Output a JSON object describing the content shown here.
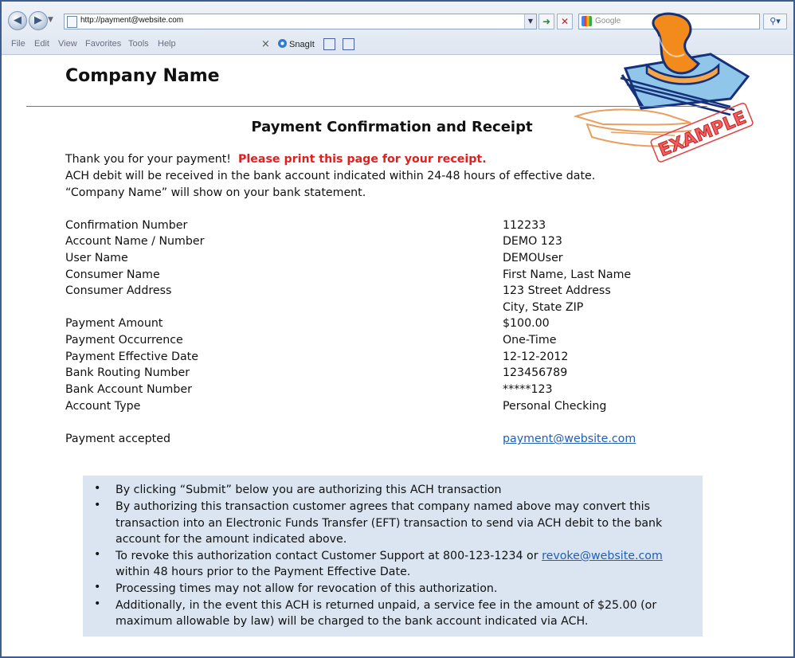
{
  "browser": {
    "url": "http://payment@website.com",
    "search_placeholder": "Google",
    "menu": [
      "File",
      "Edit",
      "View",
      "Favorites",
      "Tools",
      "Help"
    ],
    "toolbar_snagit": "SnagIt"
  },
  "page": {
    "company_name": "Company Name",
    "title": "Payment Confirmation and Receipt",
    "thanks": "Thank you for your payment!",
    "print_notice": "Please print this page for your receipt.",
    "line2": "ACH debit will be received in the bank account indicated within 24-48 hours of effective date.",
    "line3": "“Company Name” will show on your bank statement.",
    "stamp_text": "EXAMPLE"
  },
  "details": [
    {
      "label": "Confirmation Number",
      "value": "112233"
    },
    {
      "label": "Account Name / Number",
      "value": "DEMO 123"
    },
    {
      "label": "User Name",
      "value": "DEMOUser"
    },
    {
      "label": "Consumer Name",
      "value": "First Name, Last Name"
    },
    {
      "label": "Consumer Address",
      "value": "123 Street Address"
    },
    {
      "label": "",
      "value": "City, State ZIP"
    },
    {
      "label": "Payment Amount",
      "value": "$100.00"
    },
    {
      "label": "Payment Occurrence",
      "value": "One-Time"
    },
    {
      "label": "Payment Effective Date",
      "value": "12-12-2012"
    },
    {
      "label": "Bank Routing Number",
      "value": "123456789"
    },
    {
      "label": "Bank Account Number",
      "value": "*****123"
    },
    {
      "label": "Account Type",
      "value": "Personal Checking"
    }
  ],
  "accepted": {
    "label": "Payment accepted",
    "email": "payment@website.com"
  },
  "notice": {
    "b1": "By clicking “Submit” below you are authorizing this ACH transaction",
    "b2_l1": "By authorizing this transaction customer agrees that company named above may convert this",
    "b2_l2": "transaction into an Electronic Funds Transfer (EFT) transaction to send via ACH debit to the bank",
    "b2_l3": "account for the amount indicated above.",
    "b3_l1": "To revoke this authorization contact Customer Support at 800-123-1234 or",
    "b3_email": "revoke@website.com",
    "b3_l2": "within 48 hours prior to the Payment Effective Date.",
    "b4": "Processing times may not allow for revocation of this authorization.",
    "b5_l1": "Additionally, in the event this ACH is returned unpaid, a service fee in the amount of $25.00 (or",
    "b5_l2": "maximum allowable by law) will be charged to the bank account indicated via ACH."
  }
}
